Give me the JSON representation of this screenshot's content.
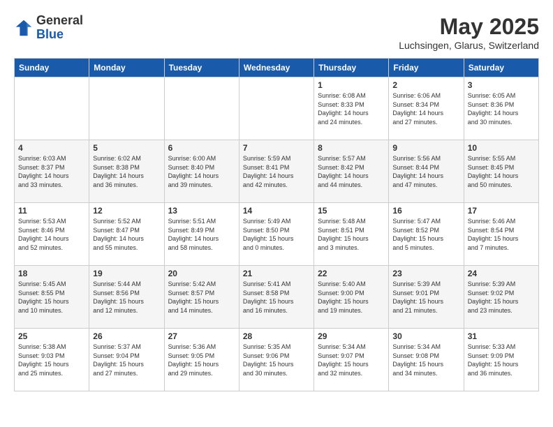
{
  "logo": {
    "general": "General",
    "blue": "Blue"
  },
  "title": "May 2025",
  "location": "Luchsingen, Glarus, Switzerland",
  "weekdays": [
    "Sunday",
    "Monday",
    "Tuesday",
    "Wednesday",
    "Thursday",
    "Friday",
    "Saturday"
  ],
  "weeks": [
    [
      {
        "day": "",
        "info": ""
      },
      {
        "day": "",
        "info": ""
      },
      {
        "day": "",
        "info": ""
      },
      {
        "day": "",
        "info": ""
      },
      {
        "day": "1",
        "info": "Sunrise: 6:08 AM\nSunset: 8:33 PM\nDaylight: 14 hours\nand 24 minutes."
      },
      {
        "day": "2",
        "info": "Sunrise: 6:06 AM\nSunset: 8:34 PM\nDaylight: 14 hours\nand 27 minutes."
      },
      {
        "day": "3",
        "info": "Sunrise: 6:05 AM\nSunset: 8:36 PM\nDaylight: 14 hours\nand 30 minutes."
      }
    ],
    [
      {
        "day": "4",
        "info": "Sunrise: 6:03 AM\nSunset: 8:37 PM\nDaylight: 14 hours\nand 33 minutes."
      },
      {
        "day": "5",
        "info": "Sunrise: 6:02 AM\nSunset: 8:38 PM\nDaylight: 14 hours\nand 36 minutes."
      },
      {
        "day": "6",
        "info": "Sunrise: 6:00 AM\nSunset: 8:40 PM\nDaylight: 14 hours\nand 39 minutes."
      },
      {
        "day": "7",
        "info": "Sunrise: 5:59 AM\nSunset: 8:41 PM\nDaylight: 14 hours\nand 42 minutes."
      },
      {
        "day": "8",
        "info": "Sunrise: 5:57 AM\nSunset: 8:42 PM\nDaylight: 14 hours\nand 44 minutes."
      },
      {
        "day": "9",
        "info": "Sunrise: 5:56 AM\nSunset: 8:44 PM\nDaylight: 14 hours\nand 47 minutes."
      },
      {
        "day": "10",
        "info": "Sunrise: 5:55 AM\nSunset: 8:45 PM\nDaylight: 14 hours\nand 50 minutes."
      }
    ],
    [
      {
        "day": "11",
        "info": "Sunrise: 5:53 AM\nSunset: 8:46 PM\nDaylight: 14 hours\nand 52 minutes."
      },
      {
        "day": "12",
        "info": "Sunrise: 5:52 AM\nSunset: 8:47 PM\nDaylight: 14 hours\nand 55 minutes."
      },
      {
        "day": "13",
        "info": "Sunrise: 5:51 AM\nSunset: 8:49 PM\nDaylight: 14 hours\nand 58 minutes."
      },
      {
        "day": "14",
        "info": "Sunrise: 5:49 AM\nSunset: 8:50 PM\nDaylight: 15 hours\nand 0 minutes."
      },
      {
        "day": "15",
        "info": "Sunrise: 5:48 AM\nSunset: 8:51 PM\nDaylight: 15 hours\nand 3 minutes."
      },
      {
        "day": "16",
        "info": "Sunrise: 5:47 AM\nSunset: 8:52 PM\nDaylight: 15 hours\nand 5 minutes."
      },
      {
        "day": "17",
        "info": "Sunrise: 5:46 AM\nSunset: 8:54 PM\nDaylight: 15 hours\nand 7 minutes."
      }
    ],
    [
      {
        "day": "18",
        "info": "Sunrise: 5:45 AM\nSunset: 8:55 PM\nDaylight: 15 hours\nand 10 minutes."
      },
      {
        "day": "19",
        "info": "Sunrise: 5:44 AM\nSunset: 8:56 PM\nDaylight: 15 hours\nand 12 minutes."
      },
      {
        "day": "20",
        "info": "Sunrise: 5:42 AM\nSunset: 8:57 PM\nDaylight: 15 hours\nand 14 minutes."
      },
      {
        "day": "21",
        "info": "Sunrise: 5:41 AM\nSunset: 8:58 PM\nDaylight: 15 hours\nand 16 minutes."
      },
      {
        "day": "22",
        "info": "Sunrise: 5:40 AM\nSunset: 9:00 PM\nDaylight: 15 hours\nand 19 minutes."
      },
      {
        "day": "23",
        "info": "Sunrise: 5:39 AM\nSunset: 9:01 PM\nDaylight: 15 hours\nand 21 minutes."
      },
      {
        "day": "24",
        "info": "Sunrise: 5:39 AM\nSunset: 9:02 PM\nDaylight: 15 hours\nand 23 minutes."
      }
    ],
    [
      {
        "day": "25",
        "info": "Sunrise: 5:38 AM\nSunset: 9:03 PM\nDaylight: 15 hours\nand 25 minutes."
      },
      {
        "day": "26",
        "info": "Sunrise: 5:37 AM\nSunset: 9:04 PM\nDaylight: 15 hours\nand 27 minutes."
      },
      {
        "day": "27",
        "info": "Sunrise: 5:36 AM\nSunset: 9:05 PM\nDaylight: 15 hours\nand 29 minutes."
      },
      {
        "day": "28",
        "info": "Sunrise: 5:35 AM\nSunset: 9:06 PM\nDaylight: 15 hours\nand 30 minutes."
      },
      {
        "day": "29",
        "info": "Sunrise: 5:34 AM\nSunset: 9:07 PM\nDaylight: 15 hours\nand 32 minutes."
      },
      {
        "day": "30",
        "info": "Sunrise: 5:34 AM\nSunset: 9:08 PM\nDaylight: 15 hours\nand 34 minutes."
      },
      {
        "day": "31",
        "info": "Sunrise: 5:33 AM\nSunset: 9:09 PM\nDaylight: 15 hours\nand 36 minutes."
      }
    ]
  ]
}
